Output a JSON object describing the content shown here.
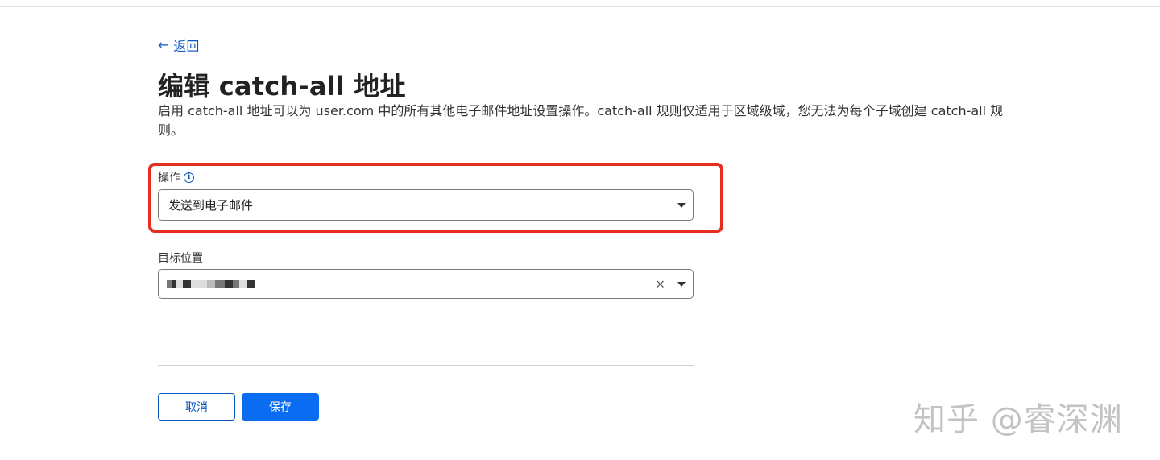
{
  "nav": {
    "back_arrow": "←",
    "back_label": "返回"
  },
  "header": {
    "title": "编辑 catch-all 地址",
    "description": "启用 catch-all 地址可以为 user.com 中的所有其他电子邮件地址设置操作。catch-all 规则仅适用于区域级域，您无法为每个子域创建 catch-all 规则。"
  },
  "form": {
    "action": {
      "label": "操作",
      "info_icon": "info-icon",
      "info_glyph": "i",
      "selected_value": "发送到电子邮件"
    },
    "target": {
      "label": "目标位置",
      "selected_value": "[redacted]",
      "clear_glyph": "×"
    }
  },
  "buttons": {
    "cancel_label": "取消",
    "save_label": "保存"
  },
  "watermark": {
    "text": "知乎 @睿深渊"
  },
  "colors": {
    "link": "#0a56c2",
    "primary_button": "#0a6cf0",
    "highlight_border": "#e62e1e"
  }
}
